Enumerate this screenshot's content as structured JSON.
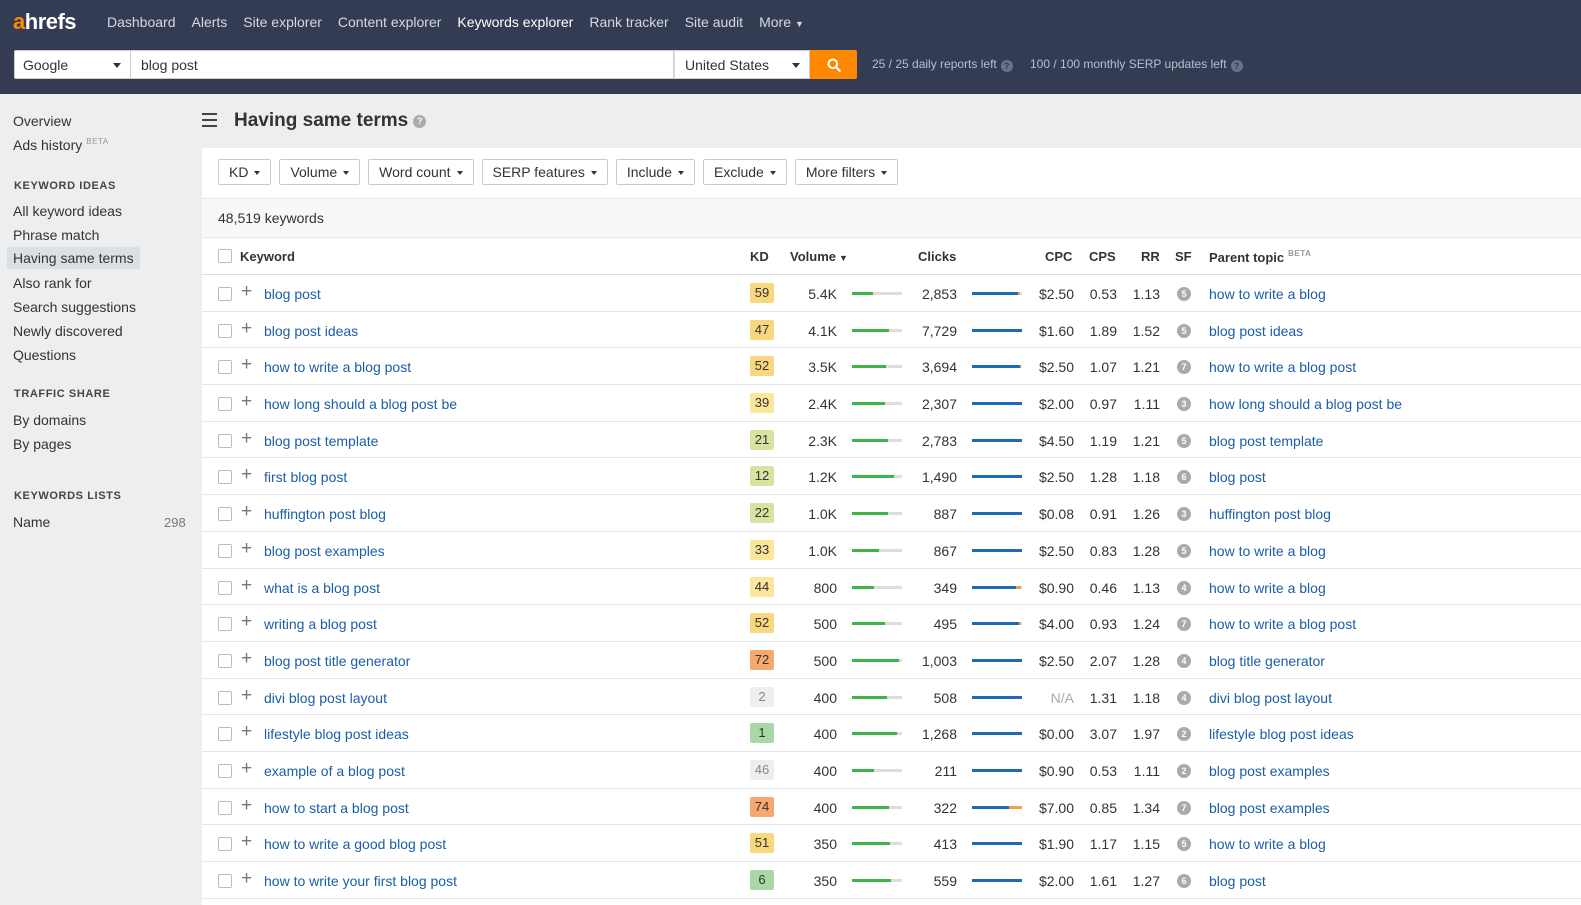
{
  "app": {
    "logo_a": "a",
    "logo_rest": "hrefs"
  },
  "nav": [
    {
      "label": "Dashboard",
      "active": false
    },
    {
      "label": "Alerts",
      "active": false
    },
    {
      "label": "Site explorer",
      "active": false
    },
    {
      "label": "Content explorer",
      "active": false
    },
    {
      "label": "Keywords explorer",
      "active": true
    },
    {
      "label": "Rank tracker",
      "active": false
    },
    {
      "label": "Site audit",
      "active": false
    },
    {
      "label": "More",
      "active": false
    }
  ],
  "search": {
    "engine": "Google",
    "query": "blog post",
    "country": "United States",
    "daily_quota": "25 / 25 daily reports left",
    "monthly_quota": "100 / 100 monthly SERP updates left"
  },
  "sidebar": {
    "overview": "Overview",
    "ads_history": "Ads history",
    "beta": "BETA",
    "keyword_ideas_heading": "KEYWORD IDEAS",
    "keyword_ideas": [
      "All keyword ideas",
      "Phrase match",
      "Having same terms",
      "Also rank for",
      "Search suggestions",
      "Newly discovered",
      "Questions"
    ],
    "active_item": "Having same terms",
    "traffic_share_heading": "TRAFFIC SHARE",
    "traffic_share": [
      "By domains",
      "By pages"
    ],
    "keywords_lists_heading": "KEYWORDS LISTS",
    "list_name": "Name",
    "list_count": "298"
  },
  "page": {
    "title": "Having same terms",
    "filters": [
      "KD",
      "Volume",
      "Word count",
      "SERP features",
      "Include",
      "Exclude",
      "More filters"
    ],
    "keyword_count": "48,519 keywords"
  },
  "table": {
    "headers": {
      "keyword": "Keyword",
      "kd": "KD",
      "volume": "Volume",
      "clicks": "Clicks",
      "cpc": "CPC",
      "cps": "CPS",
      "rr": "RR",
      "sf": "SF",
      "parent_topic": "Parent topic",
      "beta": "BETA"
    },
    "rows": [
      {
        "keyword": "blog post",
        "kd": "59",
        "volume": "5.4K",
        "vol_frac": 0.42,
        "clicks": "2,853",
        "organic": 0.92,
        "paid": 0.03,
        "cpc": "$2.50",
        "cps": "0.53",
        "rr": "1.13",
        "sf": "5",
        "parent": "how to write a blog"
      },
      {
        "keyword": "blog post ideas",
        "kd": "47",
        "volume": "4.1K",
        "vol_frac": 0.74,
        "clicks": "7,729",
        "organic": 1.0,
        "paid": 0.0,
        "cpc": "$1.60",
        "cps": "1.89",
        "rr": "1.52",
        "sf": "5",
        "parent": "blog post ideas"
      },
      {
        "keyword": "how to write a blog post",
        "kd": "52",
        "volume": "3.5K",
        "vol_frac": 0.68,
        "clicks": "3,694",
        "organic": 0.96,
        "paid": 0.02,
        "cpc": "$2.50",
        "cps": "1.07",
        "rr": "1.21",
        "sf": "7",
        "parent": "how to write a blog post"
      },
      {
        "keyword": "how long should a blog post be",
        "kd": "39",
        "volume": "2.4K",
        "vol_frac": 0.66,
        "clicks": "2,307",
        "organic": 1.0,
        "paid": 0.0,
        "cpc": "$2.00",
        "cps": "0.97",
        "rr": "1.11",
        "sf": "3",
        "parent": "how long should a blog post be"
      },
      {
        "keyword": "blog post template",
        "kd": "21",
        "volume": "2.3K",
        "vol_frac": 0.72,
        "clicks": "2,783",
        "organic": 1.0,
        "paid": 0.0,
        "cpc": "$4.50",
        "cps": "1.19",
        "rr": "1.21",
        "sf": "5",
        "parent": "blog post template"
      },
      {
        "keyword": "first blog post",
        "kd": "12",
        "volume": "1.2K",
        "vol_frac": 0.84,
        "clicks": "1,490",
        "organic": 1.0,
        "paid": 0.0,
        "cpc": "$2.50",
        "cps": "1.28",
        "rr": "1.18",
        "sf": "6",
        "parent": "blog post"
      },
      {
        "keyword": "huffington post blog",
        "kd": "22",
        "volume": "1.0K",
        "vol_frac": 0.72,
        "clicks": "887",
        "organic": 1.0,
        "paid": 0.0,
        "cpc": "$0.08",
        "cps": "0.91",
        "rr": "1.26",
        "sf": "3",
        "parent": "huffington post blog"
      },
      {
        "keyword": "blog post examples",
        "kd": "33",
        "volume": "1.0K",
        "vol_frac": 0.54,
        "clicks": "867",
        "organic": 1.0,
        "paid": 0.0,
        "cpc": "$2.50",
        "cps": "0.83",
        "rr": "1.28",
        "sf": "5",
        "parent": "how to write a blog"
      },
      {
        "keyword": "what is a blog post",
        "kd": "44",
        "volume": "800",
        "vol_frac": 0.44,
        "clicks": "349",
        "organic": 0.88,
        "paid": 0.1,
        "cpc": "$0.90",
        "cps": "0.46",
        "rr": "1.13",
        "sf": "4",
        "parent": "how to write a blog"
      },
      {
        "keyword": "writing a blog post",
        "kd": "52",
        "volume": "500",
        "vol_frac": 0.66,
        "clicks": "495",
        "organic": 0.94,
        "paid": 0.03,
        "cpc": "$4.00",
        "cps": "0.93",
        "rr": "1.24",
        "sf": "7",
        "parent": "how to write a blog post"
      },
      {
        "keyword": "blog post title generator",
        "kd": "72",
        "volume": "500",
        "vol_frac": 0.94,
        "clicks": "1,003",
        "organic": 1.0,
        "paid": 0.0,
        "cpc": "$2.50",
        "cps": "2.07",
        "rr": "1.28",
        "sf": "4",
        "parent": "blog title generator"
      },
      {
        "keyword": "divi blog post layout",
        "kd": "2",
        "volume": "400",
        "vol_frac": 0.7,
        "clicks": "508",
        "organic": 1.0,
        "paid": 0.0,
        "cpc": "N/A",
        "cps": "1.31",
        "rr": "1.18",
        "sf": "4",
        "parent": "divi blog post layout"
      },
      {
        "keyword": "lifestyle blog post ideas",
        "kd": "1",
        "volume": "400",
        "vol_frac": 0.9,
        "clicks": "1,268",
        "organic": 1.0,
        "paid": 0.0,
        "cpc": "$0.00",
        "cps": "3.07",
        "rr": "1.97",
        "sf": "2",
        "parent": "lifestyle blog post ideas"
      },
      {
        "keyword": "example of a blog post",
        "kd": "46",
        "volume": "400",
        "vol_frac": 0.44,
        "clicks": "211",
        "organic": 1.0,
        "paid": 0.0,
        "cpc": "$0.90",
        "cps": "0.53",
        "rr": "1.11",
        "sf": "2",
        "parent": "blog post examples"
      },
      {
        "keyword": "how to start a blog post",
        "kd": "74",
        "volume": "400",
        "vol_frac": 0.74,
        "clicks": "322",
        "organic": 0.74,
        "paid": 0.26,
        "cpc": "$7.00",
        "cps": "0.85",
        "rr": "1.34",
        "sf": "7",
        "parent": "blog post examples"
      },
      {
        "keyword": "how to write a good blog post",
        "kd": "51",
        "volume": "350",
        "vol_frac": 0.76,
        "clicks": "413",
        "organic": 1.0,
        "paid": 0.0,
        "cpc": "$1.90",
        "cps": "1.17",
        "rr": "1.15",
        "sf": "5",
        "parent": "how to write a blog"
      },
      {
        "keyword": "how to write your first blog post",
        "kd": "6",
        "volume": "350",
        "vol_frac": 0.78,
        "clicks": "559",
        "organic": 1.0,
        "paid": 0.0,
        "cpc": "$2.00",
        "cps": "1.61",
        "rr": "1.27",
        "sf": "6",
        "parent": "blog post"
      }
    ]
  },
  "colors": {
    "topbar": "#333c52",
    "accent": "#ff8800",
    "link": "#1a5ea8",
    "kd_scale": [
      "#d6ecd8",
      "#a8d8a6",
      "#d8e2a1",
      "#fce69c",
      "#f9d77e",
      "#f5a96f"
    ]
  },
  "icons": [
    "search-icon",
    "help-icon",
    "menu-icon",
    "plus-icon",
    "checkbox-icon"
  ]
}
